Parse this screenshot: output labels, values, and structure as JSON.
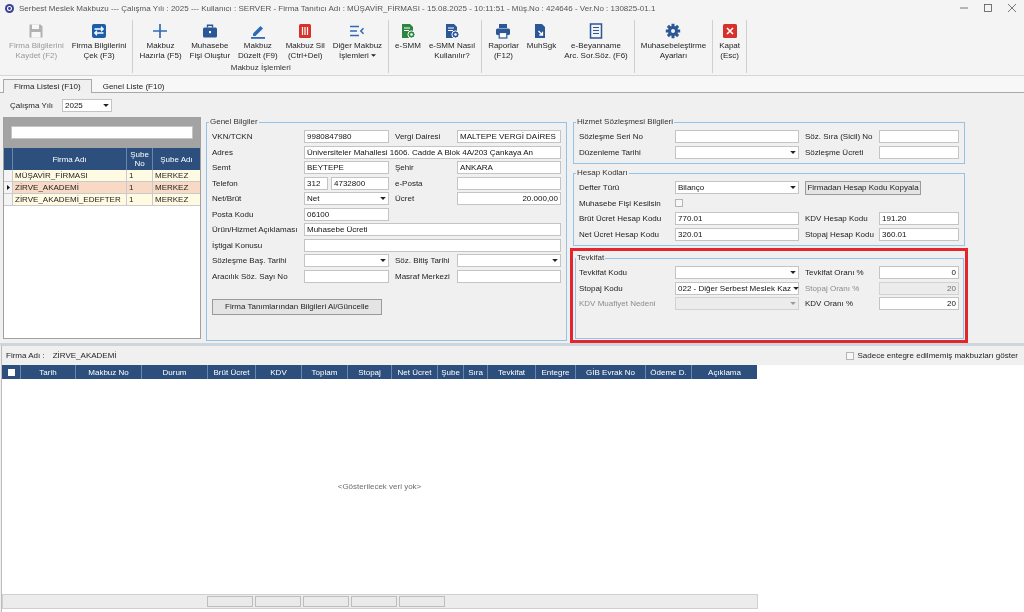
{
  "window": {
    "title": "Serbest Meslek Makbuzu --- Çalışma Yılı : 2025 --- Kullanıcı : SERVER - Firma Tanıtıcı Adı : MÜŞAVİR_FİRMASI - 15.08.2025 - 10:11:51 - Müş.No : 424646 - Ver.No : 130825-01.1"
  },
  "toolbar": {
    "groups": [
      {
        "buttons": [
          {
            "label": "Firma Bilgilerini\nKaydet (F2)",
            "kind": "push",
            "disabled": true
          },
          {
            "label": "Firma Bilgilerini\nÇek (F3)",
            "kind": "push",
            "disabled": false
          }
        ]
      },
      {
        "caption": "Makbuz İşlemleri",
        "buttons": [
          {
            "label": "Makbuz\nHazırla (F5)",
            "kind": "push",
            "disabled": false
          },
          {
            "label": "Muhasebe\nFişi Oluştur",
            "kind": "push",
            "disabled": false
          },
          {
            "label": "Makbuz\nDüzelt (F9)",
            "kind": "push",
            "disabled": false
          },
          {
            "label": "Makbuz Sil\n(Ctrl+Del)",
            "kind": "push",
            "disabled": false
          },
          {
            "label": "Diğer Makbuz\nİşlemleri",
            "kind": "dropdown",
            "disabled": false
          }
        ]
      },
      {
        "buttons": [
          {
            "label": "e-SMM",
            "kind": "push",
            "disabled": false
          },
          {
            "label": "e-SMM Nasıl\nKullanılır?",
            "kind": "push",
            "disabled": false
          }
        ]
      },
      {
        "buttons": [
          {
            "label": "Raporlar\n(F12)",
            "kind": "push",
            "disabled": false
          },
          {
            "label": "MuhSgk",
            "kind": "push",
            "disabled": false
          },
          {
            "label": "e-Beyanname\nArc. Sor.Söz. (F6)",
            "kind": "push",
            "disabled": false
          }
        ]
      },
      {
        "buttons": [
          {
            "label": "Muhasebeleştirme\nAyarları",
            "kind": "push",
            "disabled": false
          }
        ]
      },
      {
        "buttons": [
          {
            "label": "Kapat\n(Esc)",
            "kind": "push",
            "disabled": false
          }
        ]
      }
    ]
  },
  "tabs": [
    {
      "label": "Firma Listesi (F10)",
      "selected": true
    },
    {
      "label": "Genel Liste (F10)",
      "selected": false
    }
  ],
  "year": {
    "label": "Çalışma Yılı",
    "value": "2025"
  },
  "firm_list": {
    "columns": [
      "Firma Adı",
      "Şube\nNo",
      "Şube Adı"
    ],
    "rows": [
      {
        "cells": [
          "MÜŞAVİR_FİRMASI",
          "1",
          "MERKEZ"
        ],
        "selected": false
      },
      {
        "cells": [
          "ZİRVE_AKADEMİ",
          "1",
          "MERKEZ"
        ],
        "selected": true
      },
      {
        "cells": [
          "ZİRVE_AKADEMİ_EDEFTER",
          "1",
          "MERKEZ"
        ],
        "selected": false
      }
    ]
  },
  "general": {
    "title": "Genel Bilgiler",
    "rows": [
      [
        {
          "label": "VKN/TCKN",
          "kind": "text",
          "value": "9980847980"
        },
        {
          "label": "Vergi Dairesi",
          "kind": "text",
          "value": "MALTEPE VERGİ DAİRES"
        }
      ],
      [
        {
          "label": "Adres",
          "kind": "wide",
          "value": "Üniversiteler Mahallesi 1606. Cadde A Blok 4A/203 Çankaya An"
        }
      ],
      [
        {
          "label": "Semt",
          "kind": "text",
          "value": "BEYTEPE"
        },
        {
          "label": "Şehir",
          "kind": "text",
          "value": "ANKARA"
        }
      ],
      [
        {
          "label": "Telefon",
          "kind": "phone",
          "area_code": "312",
          "value": "4732800"
        },
        {
          "label": "e-Posta",
          "kind": "text"
        }
      ],
      [
        {
          "label": "Net/Brüt",
          "kind": "combo",
          "value": "Net"
        },
        {
          "label": "Ücret",
          "kind": "amount",
          "value": "20.000,00"
        }
      ],
      [
        {
          "label": "Posta Kodu",
          "kind": "text",
          "value": "06100"
        }
      ],
      [
        {
          "label": "Ürün/Hizmet Açıklaması",
          "kind": "wide",
          "value": "Muhasebe Ücreti"
        }
      ],
      [
        {
          "label": "İştigal Konusu",
          "kind": "wide"
        }
      ],
      [
        {
          "label": "Sözleşme Baş. Tarihi",
          "kind": "combo"
        },
        {
          "label": "Söz. Bitiş Tarihi",
          "kind": "combo"
        }
      ],
      [
        {
          "label": "Aracılık Söz. Sayı No",
          "kind": "text"
        },
        {
          "label": "Masraf Merkezi",
          "kind": "text"
        }
      ]
    ],
    "button": "Firma Tanımlarından Bilgileri Al/Güncelle"
  },
  "contract": {
    "title": "Hizmet Sözleşmesi Bilgileri",
    "rows": [
      [
        {
          "label": "Sözleşme Seri No",
          "kind": "text"
        },
        {
          "label": "Söz. Sıra (Sicil) No",
          "kind": "text"
        }
      ],
      [
        {
          "label": "Düzenleme Tarihi",
          "kind": "combo"
        },
        {
          "label": "Sözleşme Ücreti",
          "kind": "text"
        }
      ]
    ]
  },
  "accounts": {
    "title": "Hesap Kodları",
    "rows": [
      [
        {
          "label": "Defter Türü",
          "kind": "combo",
          "value": "Bilanço"
        },
        {
          "label": "Firmadan Hesap Kodu Kopyala",
          "kind": "button"
        }
      ],
      [
        {
          "label": "Muhasebe Fişi Kesilsin",
          "kind": "check",
          "checked": false
        }
      ],
      [
        {
          "label": "Brüt Ücret Hesap Kodu",
          "kind": "text",
          "value": "770.01"
        },
        {
          "label": "KDV Hesap Kodu",
          "kind": "text",
          "value": "191.20"
        }
      ],
      [
        {
          "label": "Net Ücret Hesap Kodu",
          "kind": "text",
          "value": "320.01"
        },
        {
          "label": "Stopaj Hesap Kodu",
          "kind": "text",
          "value": "360.01"
        }
      ]
    ]
  },
  "withholding": {
    "title": "Tevkifat",
    "highlighted": true,
    "rows": [
      [
        {
          "label": "Tevkifat Kodu",
          "kind": "combo",
          "disabled": false
        },
        {
          "label": "Tevkifat Oranı %",
          "kind": "amount",
          "value": "0",
          "disabled": false
        }
      ],
      [
        {
          "label": "Stopaj Kodu",
          "kind": "combo",
          "value": "022 - Diğer Serbest Meslek Kaz",
          "disabled": false
        },
        {
          "label": "Stopaj Oranı %",
          "kind": "amount",
          "value": "20",
          "disabled": true
        }
      ],
      [
        {
          "label": "KDV Muafiyet Nedeni",
          "kind": "combo",
          "disabled": true
        },
        {
          "label": "KDV Oranı %",
          "kind": "amount",
          "value": "20",
          "disabled": false
        }
      ]
    ]
  },
  "receipts": {
    "firm_label": "Firma Adı :",
    "firm_name": "ZİRVE_AKADEMİ",
    "filter": {
      "label": "Sadece entegre edilmemiş makbuzları göster",
      "checked": false
    },
    "select_all": {
      "checked": false
    },
    "columns": [
      "Tarih",
      "Makbuz No",
      "Durum",
      "Brüt Ücret",
      "KDV",
      "Toplam",
      "Stopaj",
      "Net Ücret",
      "Şube",
      "Sıra",
      "Tevkifat",
      "Entegre",
      "GİB Evrak No",
      "Ödeme D.",
      "Açıklama"
    ],
    "empty_text": "<Gösterilecek veri yok>"
  }
}
